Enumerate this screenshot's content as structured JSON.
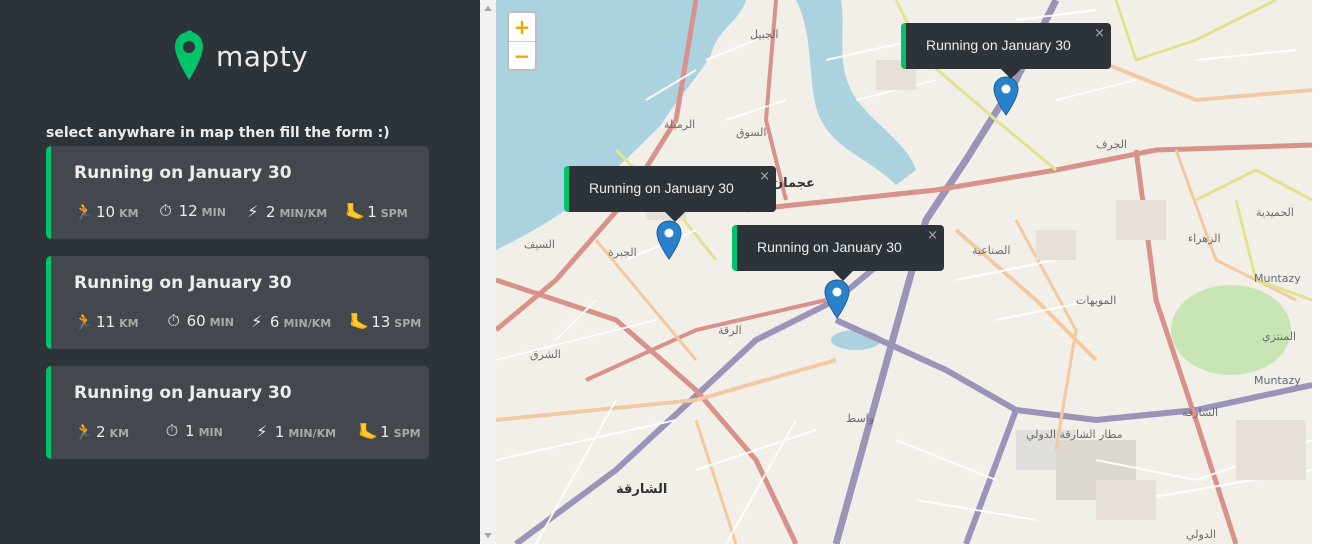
{
  "brand": {
    "name": "mapty",
    "logo_icon": "map-pin-logo-icon",
    "accent": "#00c46a"
  },
  "sidebar": {
    "hint": "select anywhare in map then fill the form :)",
    "workouts": [
      {
        "title": "Running on January 30",
        "distance": "10",
        "distance_unit": "KM",
        "duration": "12",
        "duration_unit": "MIN",
        "pace": "2",
        "pace_unit": "MIN/KM",
        "cadence": "1",
        "cadence_unit": "SPM"
      },
      {
        "title": "Running on January 30",
        "distance": "11",
        "distance_unit": "KM",
        "duration": "60",
        "duration_unit": "MIN",
        "pace": "6",
        "pace_unit": "MIN/KM",
        "cadence": "13",
        "cadence_unit": "SPM"
      },
      {
        "title": "Running on January 30",
        "distance": "2",
        "distance_unit": "KM",
        "duration": "1",
        "duration_unit": "MIN",
        "pace": "1",
        "pace_unit": "MIN/KM",
        "cadence": "1",
        "cadence_unit": "SPM"
      }
    ],
    "icons": {
      "distance": "🏃",
      "duration": "⏱",
      "pace": "⚡",
      "cadence": "🦶"
    }
  },
  "map": {
    "zoom_in": "+",
    "zoom_out": "−",
    "popups": [
      {
        "text": "Running on January 30",
        "close": "×"
      },
      {
        "text": "Running on January 30",
        "close": "×"
      },
      {
        "text": "Running on January 30",
        "close": "×"
      }
    ],
    "labels": {
      "sharjah": "الشارقة",
      "muntazy1": "Muntazy",
      "muntazy2": "Muntazy",
      "l1": "الرميلة",
      "l2": "السوق",
      "l3": "الشرق",
      "l4": "الجبيل",
      "l5": "الرقة",
      "l6": "الصناعية",
      "l7": "الموبهات",
      "l8": "الشارقة",
      "l9": "مطار الشارقة الدولي",
      "l10": "المنتزي",
      "l11": "عجمان",
      "l12": "واسط",
      "l13": "الجرف",
      "l14": "الحميدية",
      "l15": "الزهراء",
      "l16": "السيف",
      "l17": "الجبرة",
      "l18": "الدولي"
    }
  }
}
